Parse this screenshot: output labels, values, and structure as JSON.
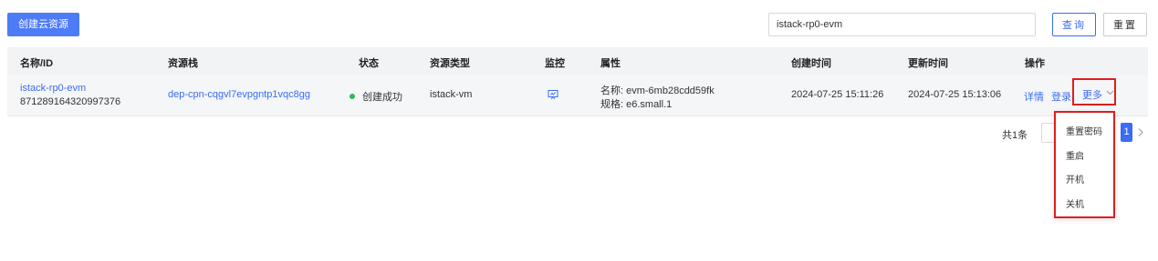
{
  "toolbar": {
    "create_label": "创建云资源",
    "search_value": "istack-rp0-evm",
    "query_label": "查询",
    "reset_label": "重置"
  },
  "table": {
    "columns": [
      "名称/ID",
      "资源栈",
      "状态",
      "资源类型",
      "监控",
      "属性",
      "创建时间",
      "更新时间",
      "操作"
    ],
    "rows": [
      {
        "name": "istack-rp0-evm",
        "id": "871289164320997376",
        "stack": "dep-cpn-cqgvl7evpgntp1vqc8gg",
        "status": "创建成功",
        "resource_type": "istack-vm",
        "attr_name": "名称: evm-6mb28cdd59fk",
        "attr_spec": "规格: e6.small.1",
        "created": "2024-07-25 15:11:26",
        "updated": "2024-07-25 15:13:06",
        "action_detail": "详情",
        "action_login": "登录",
        "action_more": "更多"
      }
    ]
  },
  "pagination": {
    "total": "共1条",
    "current_page": "1"
  },
  "dropdown": {
    "items": [
      "重置密码",
      "重启",
      "开机",
      "关机"
    ]
  },
  "colors": {
    "primary": "#3b6cf2",
    "create_button": "#4d7cf6",
    "success": "#2fb85a",
    "highlight": "#e11d1d"
  },
  "icons": {
    "monitor": "monitor-icon",
    "more_chevron": "chevron-down-icon",
    "next_page": "chevron-right-icon"
  }
}
